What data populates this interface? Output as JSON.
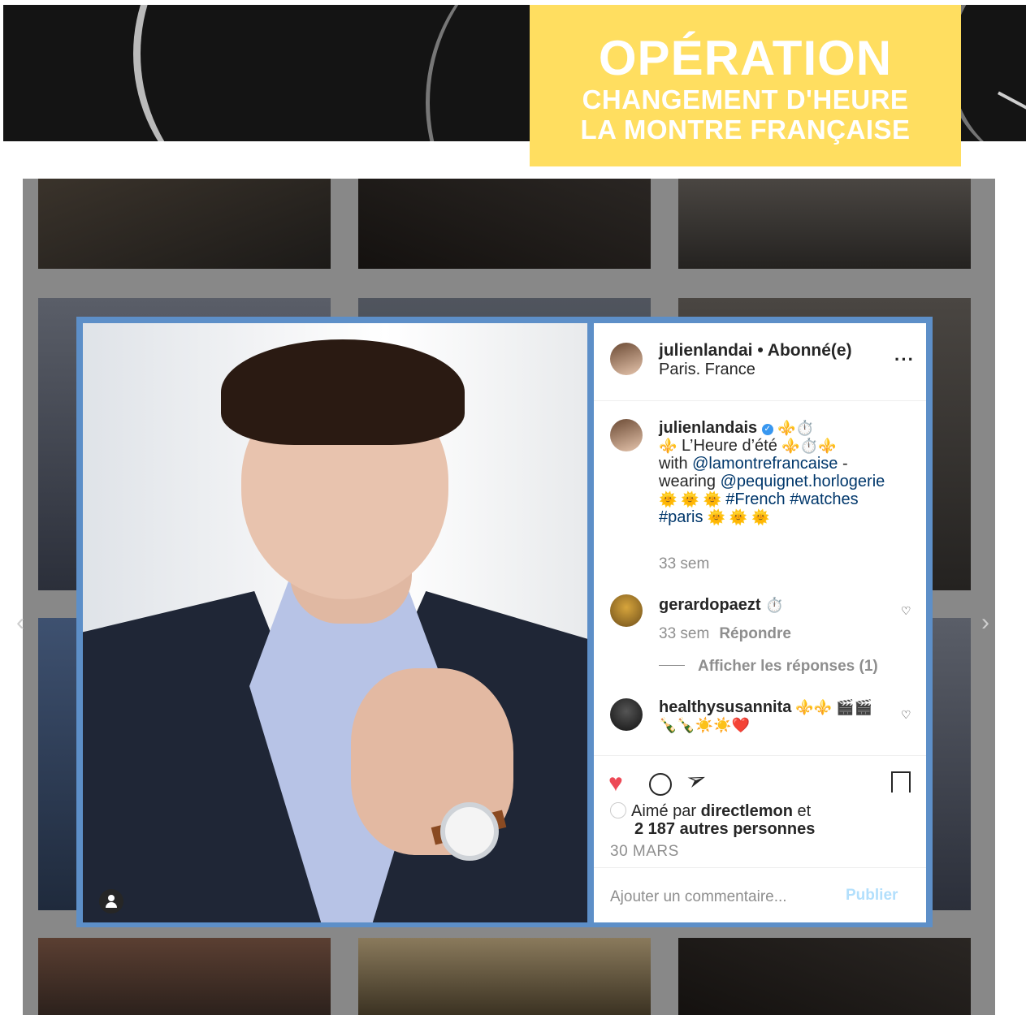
{
  "banner": {
    "title": "OPÉRATION",
    "line2": "CHANGEMENT D'HEURE",
    "line3": "LA MONTRE FRANÇAISE",
    "accent_color": "#ffde60"
  },
  "post": {
    "header": {
      "username": "julienlandai",
      "separator": " • ",
      "follow_status": "Abonné(e)",
      "location": "Paris. France",
      "more_icon": "more-dots-icon"
    },
    "caption": {
      "username": "julienlandais",
      "emoji_after_name": "⚜️⏱️",
      "line1_prefix": "⚜️",
      "line1_text": " L’Heure d’été ",
      "line1_suffix": "⚜️⏱️⚜️",
      "with_text": "with ",
      "mention1": "@lamontrefrancaise",
      "dash_text": " - wearing ",
      "mention2": "@pequignet.horlogerie",
      "emoji_sun1": " 🌞 🌞 🌞 ",
      "hashtag1": "#French",
      "hashtag2": "#watches",
      "hashtag3": "#paris",
      "emoji_sun2": " 🌞 🌞 🌞",
      "time": "33 sem"
    },
    "comments": [
      {
        "username": "gerardopaezt",
        "emoji": "⏱️",
        "time": "33 sem",
        "reply_label": "Répondre",
        "view_replies": "Afficher les réponses (1)"
      },
      {
        "username": "healthysusannita",
        "text": " ⚜️⚜️ 🎬🎬🍾🍾☀️☀️❤️"
      }
    ],
    "likes": {
      "prefix": "Aimé par ",
      "user": "directlemon",
      "middle": " et ",
      "others": "2 187 autres personnes"
    },
    "date": "30 MARS",
    "comment_input": {
      "placeholder": "Ajouter un commentaire...",
      "publish_label": "Publier"
    },
    "colors": {
      "like": "#ed4956",
      "link": "#00376b",
      "publish": "#b2dffc",
      "modal_border": "#5d8fc8"
    }
  }
}
